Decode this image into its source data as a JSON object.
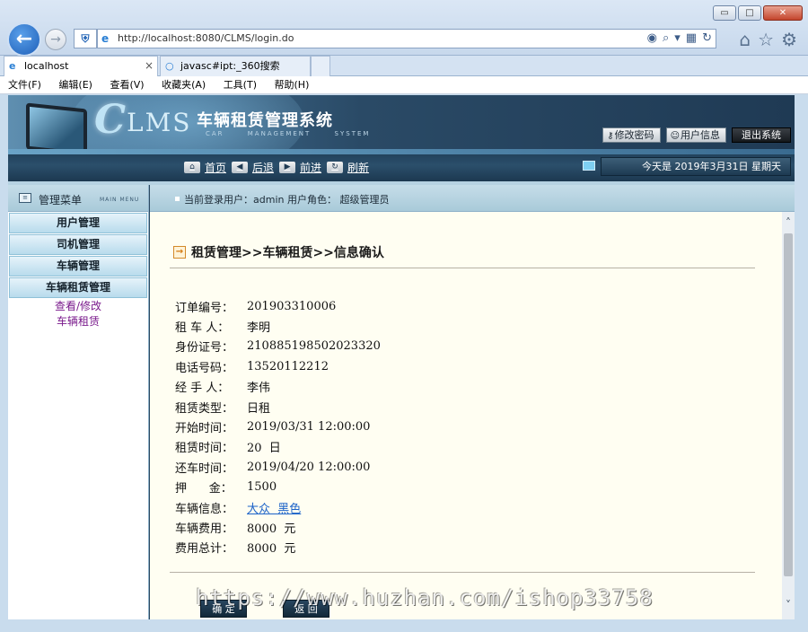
{
  "browser": {
    "url": "http://localhost:8080/CLMS/login.do",
    "tabs": [
      {
        "label": "localhost",
        "active": true
      },
      {
        "label": "javasc#ipt:_360搜索",
        "active": false
      }
    ],
    "menu": [
      "文件(F)",
      "编辑(E)",
      "查看(V)",
      "收藏夹(A)",
      "工具(T)",
      "帮助(H)"
    ],
    "window_buttons": {
      "minimize": "▭",
      "maximize": "□",
      "close": "✕"
    }
  },
  "header": {
    "logo_letter": "C",
    "logo_rest": "LMS",
    "title": "车辆租赁管理系统",
    "subtitle": "CAR MANAGEMENT SYSTEM",
    "buttons": {
      "change_password": "修改密码",
      "user_info": "用户信息",
      "logout": "退出系统"
    }
  },
  "nav": {
    "home": "首页",
    "back": "后退",
    "forward": "前进",
    "refresh": "刷新",
    "date": "今天是  2019年3月31日  星期天"
  },
  "sidebar": {
    "title": "管理菜单",
    "title_en": "MAIN MENU",
    "items": [
      "用户管理",
      "司机管理",
      "车辆管理",
      "车辆租赁管理"
    ],
    "subitems": [
      "查看/修改",
      "车辆租赁"
    ]
  },
  "user_bar": "当前登录用户：admin  用户角色：  超级管理员",
  "page": {
    "breadcrumb": "租赁管理>>车辆租赁>>信息确认",
    "fields": [
      {
        "label": "订单编号：",
        "value": "201903310006"
      },
      {
        "label": "租 车 人：",
        "value": "李明"
      },
      {
        "label": "身份证号：",
        "value": "210885198502023320"
      },
      {
        "label": "电话号码：",
        "value": "13520112212"
      },
      {
        "label": "经 手 人：",
        "value": "李伟"
      },
      {
        "label": "租赁类型：",
        "value": "日租"
      },
      {
        "label": "开始时间：",
        "value": "2019/03/31 12:00:00"
      },
      {
        "label": "租赁时间：",
        "value": "20  日"
      },
      {
        "label": "还车时间：",
        "value": "2019/04/20 12:00:00"
      },
      {
        "label": "押      金：",
        "value": "1500"
      },
      {
        "label": "车辆信息：",
        "value": "大众  黑色"
      },
      {
        "label": "车辆费用：",
        "value": "8000  元"
      },
      {
        "label": "费用总计：",
        "value": "8000  元"
      }
    ],
    "buttons": {
      "confirm": "确 定",
      "back": "返 回"
    }
  },
  "watermark": "https://www.huzhan.com/ishop33758",
  "colors": {
    "banner": "#2a4a66",
    "content_bg": "#fffef2",
    "link": "#1b62c8",
    "submenu": "#7a1a8c"
  }
}
